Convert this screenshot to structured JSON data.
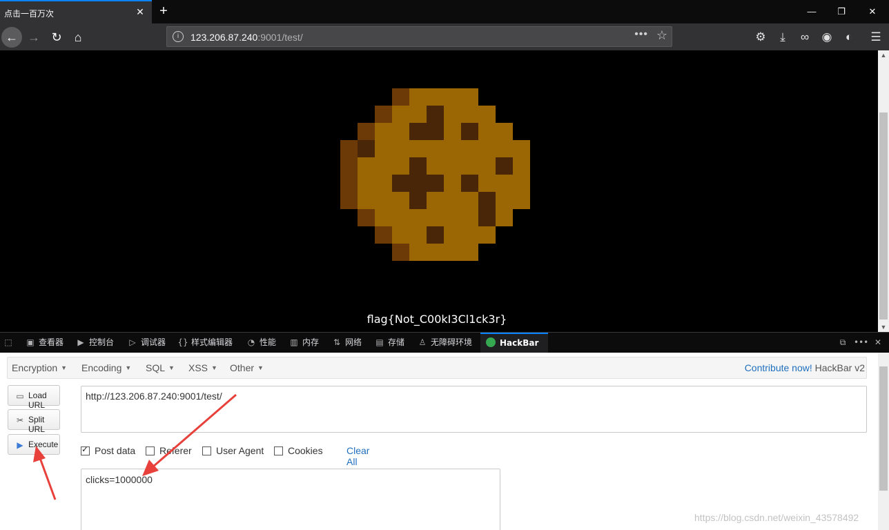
{
  "browser": {
    "tab_title": "点击一百万次",
    "url_host": "123.206.87.240",
    "url_rest": ":9001/test/"
  },
  "page": {
    "flag_text": "flag{Not_C00kI3Cl1ck3r}"
  },
  "devtools": {
    "tabs": [
      {
        "label": "查看器",
        "icon": "inspector-icon"
      },
      {
        "label": "控制台",
        "icon": "console-icon"
      },
      {
        "label": "调试器",
        "icon": "debugger-icon"
      },
      {
        "label": "样式编辑器",
        "icon": "style-editor-icon"
      },
      {
        "label": "性能",
        "icon": "performance-icon"
      },
      {
        "label": "内存",
        "icon": "memory-icon"
      },
      {
        "label": "网络",
        "icon": "network-icon"
      },
      {
        "label": "存储",
        "icon": "storage-icon"
      },
      {
        "label": "无障碍环境",
        "icon": "accessibility-icon"
      },
      {
        "label": "HackBar",
        "icon": "hackbar-icon"
      }
    ]
  },
  "hackbar": {
    "menu": [
      "Encryption",
      "Encoding",
      "SQL",
      "XSS",
      "Other"
    ],
    "contribute_link": "Contribute now!",
    "version": "HackBar v2",
    "buttons": {
      "load": "Load URL",
      "split": "Split URL",
      "execute": "Execute"
    },
    "url_value": "http://123.206.87.240:9001/test/",
    "options": [
      {
        "label": "Post data",
        "checked": true
      },
      {
        "label": "Referer",
        "checked": false
      },
      {
        "label": "User Agent",
        "checked": false
      },
      {
        "label": "Cookies",
        "checked": false
      }
    ],
    "clear_all": "Clear All",
    "post_value": "clicks=1000000"
  },
  "watermark": "https://blog.csdn.net/weixin_43578492",
  "colors": {
    "accent": "#0a84ff",
    "cookie_main": "#9b6604",
    "cookie_dark": "#4a2608",
    "cookie_edge": "#6b3a06",
    "annotation": "#e8413c"
  }
}
